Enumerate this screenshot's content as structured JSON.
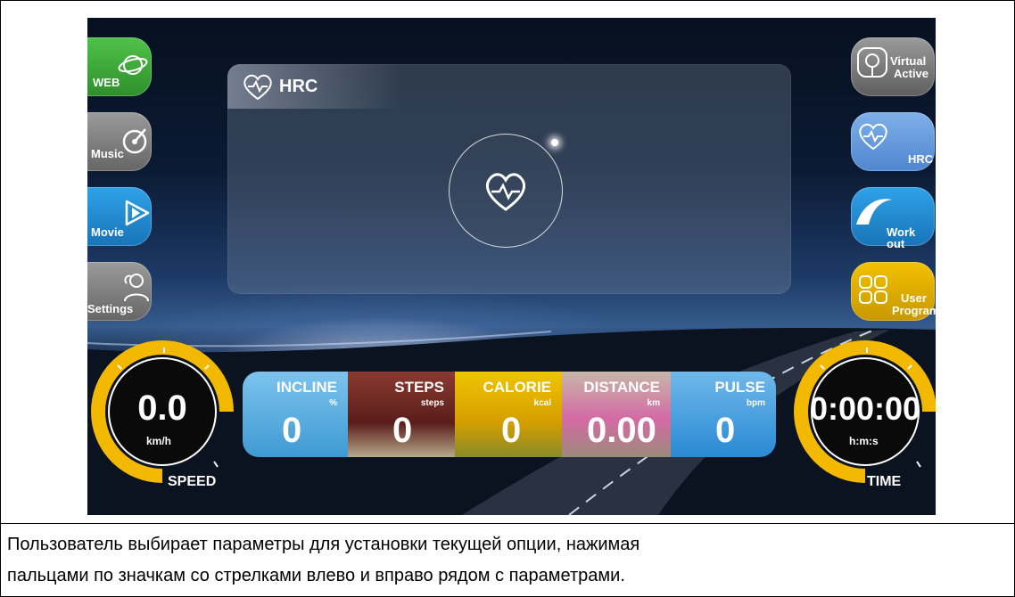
{
  "side_left": [
    {
      "label": "WEB",
      "icon": "planet-icon",
      "color": "#3fae3a"
    },
    {
      "label": "Music",
      "icon": "music-disc-icon",
      "color": "#8a8a8a"
    },
    {
      "label": "Movie",
      "icon": "film-play-icon",
      "color": "#1f8fd6"
    },
    {
      "label": "Settings",
      "icon": "user-settings-icon",
      "color": "#8a8a8a"
    }
  ],
  "side_right": [
    {
      "label_line1": "Virtual",
      "label_line2": "Active",
      "icon": "location-pin-icon",
      "color": "#8a8a8a"
    },
    {
      "label_line1": "HRC",
      "label_line2": "",
      "icon": "heart-pulse-icon",
      "color": "#6a9ee0"
    },
    {
      "label_line1": "Work out",
      "label_line2": "",
      "icon": "wave-icon",
      "color": "#1f8fd6"
    },
    {
      "label_line1": "User",
      "label_line2": "Program",
      "icon": "grid-icon",
      "color": "#e8b200"
    }
  ],
  "panel": {
    "title": "HRC",
    "icon": "heart-pulse-icon"
  },
  "speed": {
    "value": "0.0",
    "unit": "km/h",
    "caption": "SPEED",
    "color": "#f3b900"
  },
  "time": {
    "value": "0:00:00",
    "unit": "h:m:s",
    "caption": "TIME",
    "color": "#f3b900"
  },
  "stats": [
    {
      "title": "INCLINE",
      "unit": "%",
      "value": "0",
      "color": "#5fb1e3"
    },
    {
      "title": "STEPS",
      "unit": "steps",
      "value": "0",
      "color": "#7a2a2a"
    },
    {
      "title": "CALORIE",
      "unit": "kcal",
      "value": "0",
      "color": "#e8b200"
    },
    {
      "title": "DISTANCE",
      "unit": "km",
      "value": "0.00",
      "color": "#c96aa0"
    },
    {
      "title": "PULSE",
      "unit": "bpm",
      "value": "0",
      "color": "#3a9ee0"
    }
  ],
  "caption": {
    "line1": "Пользователь выбирает параметры для установки текущей опции, нажимая",
    "line2": "пальцами по значкам со стрелками влево и вправо рядом с параметрами."
  }
}
